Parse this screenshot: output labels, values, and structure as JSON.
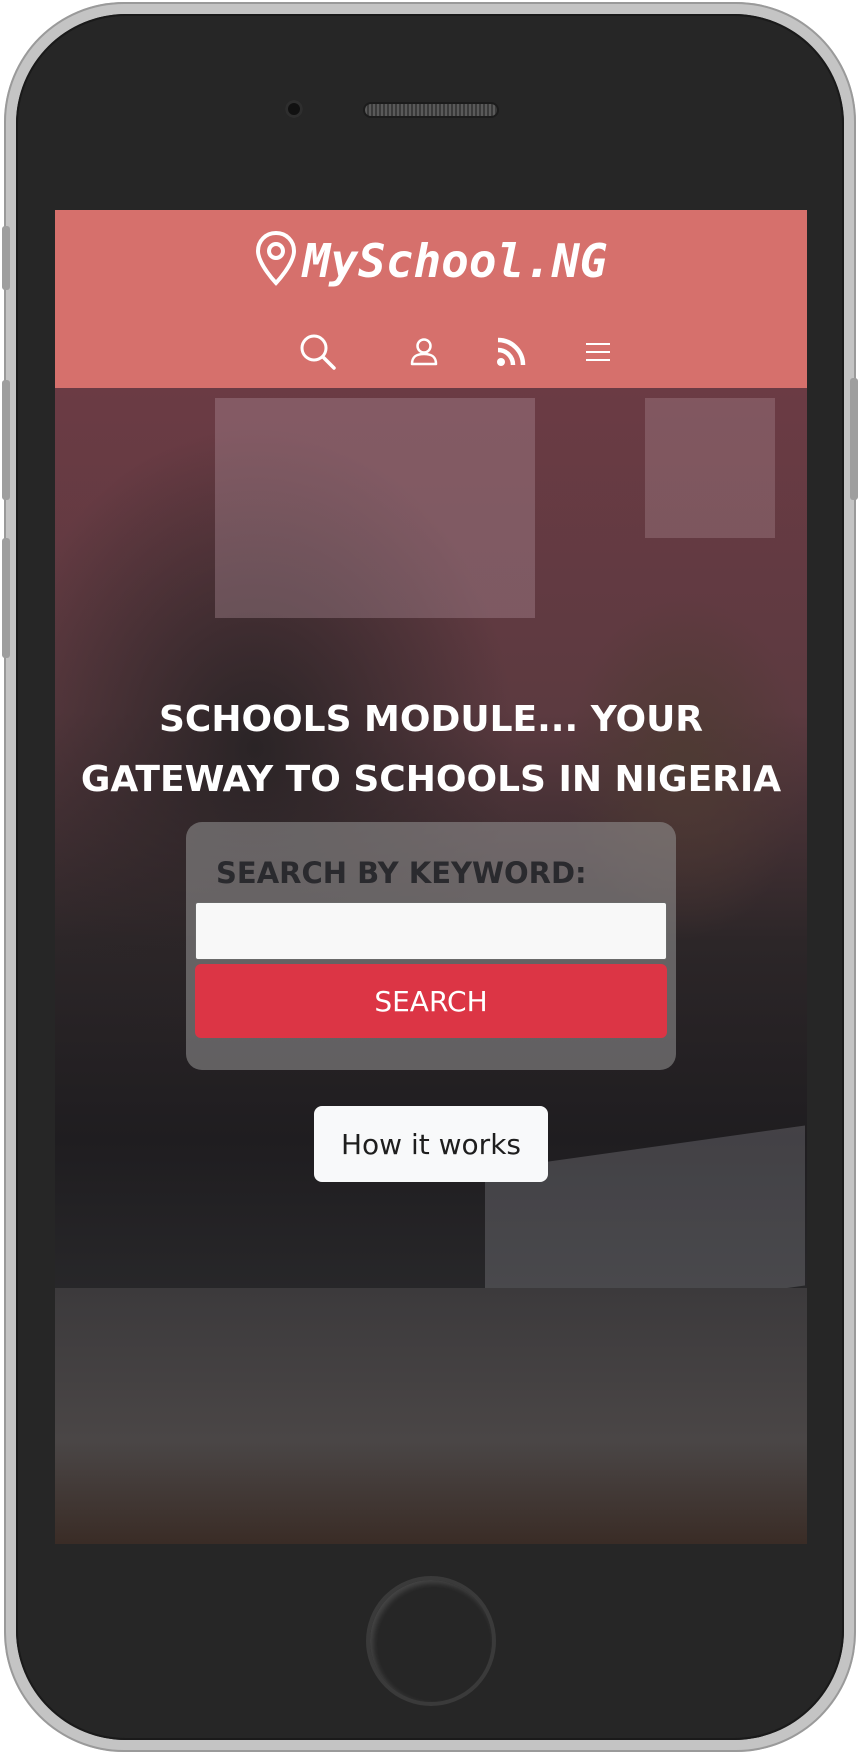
{
  "header": {
    "brand": "MySchool.NG",
    "brand_icon": "location-pin-icon",
    "nav_icons": [
      "search-icon",
      "user-icon",
      "rss-icon",
      "menu-icon"
    ]
  },
  "hero": {
    "title": "SCHOOLS MODULE... YOUR GATEWAY TO SCHOOLS IN NIGERIA",
    "search": {
      "label": "SEARCH BY KEYWORD:",
      "value": "",
      "placeholder": "",
      "button_label": "SEARCH"
    },
    "how_it_works_label": "How it works"
  },
  "colors": {
    "header_bg": "#d6706c",
    "search_button": "#dc3545",
    "how_button": "#f8f9fa",
    "phone_body": "#262626"
  }
}
